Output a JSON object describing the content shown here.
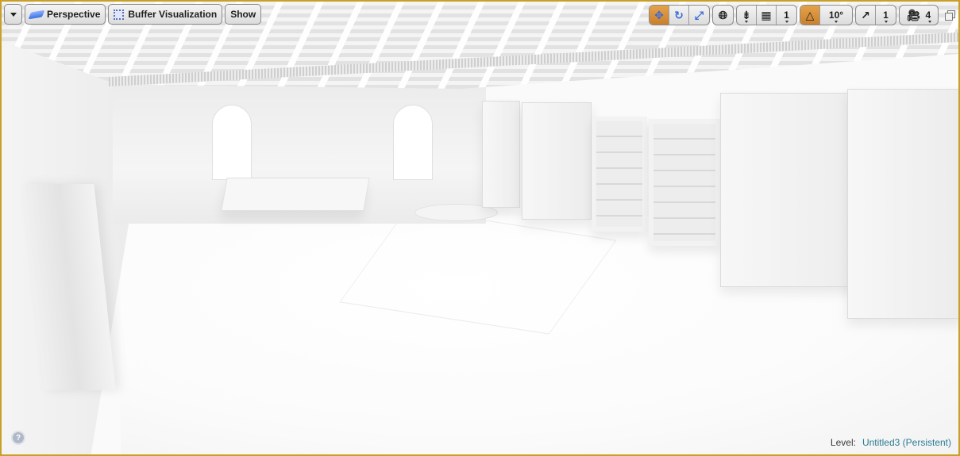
{
  "viewport": {
    "toolbar_left": {
      "menu_icon": "chevron-down-icon",
      "perspective_label": "Perspective",
      "buffer_label": "Buffer Visualization",
      "show_label": "Show"
    },
    "toolbar_right": {
      "transform_tools": [
        {
          "name": "translate",
          "icon": "move-icon",
          "active": true
        },
        {
          "name": "rotate",
          "icon": "rotate-icon",
          "active": false
        },
        {
          "name": "scale",
          "icon": "scale-icon",
          "active": false
        }
      ],
      "coordinate_system_icon": "globe-icon",
      "surface_snapping_icon": "surface-snap-icon",
      "grid_snap": {
        "icon": "grid-icon",
        "value": "1"
      },
      "rotation_snap": {
        "icon": "angle-icon",
        "value": "10°",
        "active": true
      },
      "scale_snap": {
        "icon": "scale-arrow-icon",
        "value": "1"
      },
      "camera_speed": {
        "icon": "camera-icon",
        "value": "4"
      },
      "maximize_icon": "maximize-icon"
    },
    "status": {
      "level_label": "Level:",
      "level_name": "Untitled3 (Persistent)"
    },
    "help_icon": "help-icon",
    "colors": {
      "border": "#c8a028",
      "active": "#d88d38",
      "level_name": "#2a7c94"
    }
  }
}
